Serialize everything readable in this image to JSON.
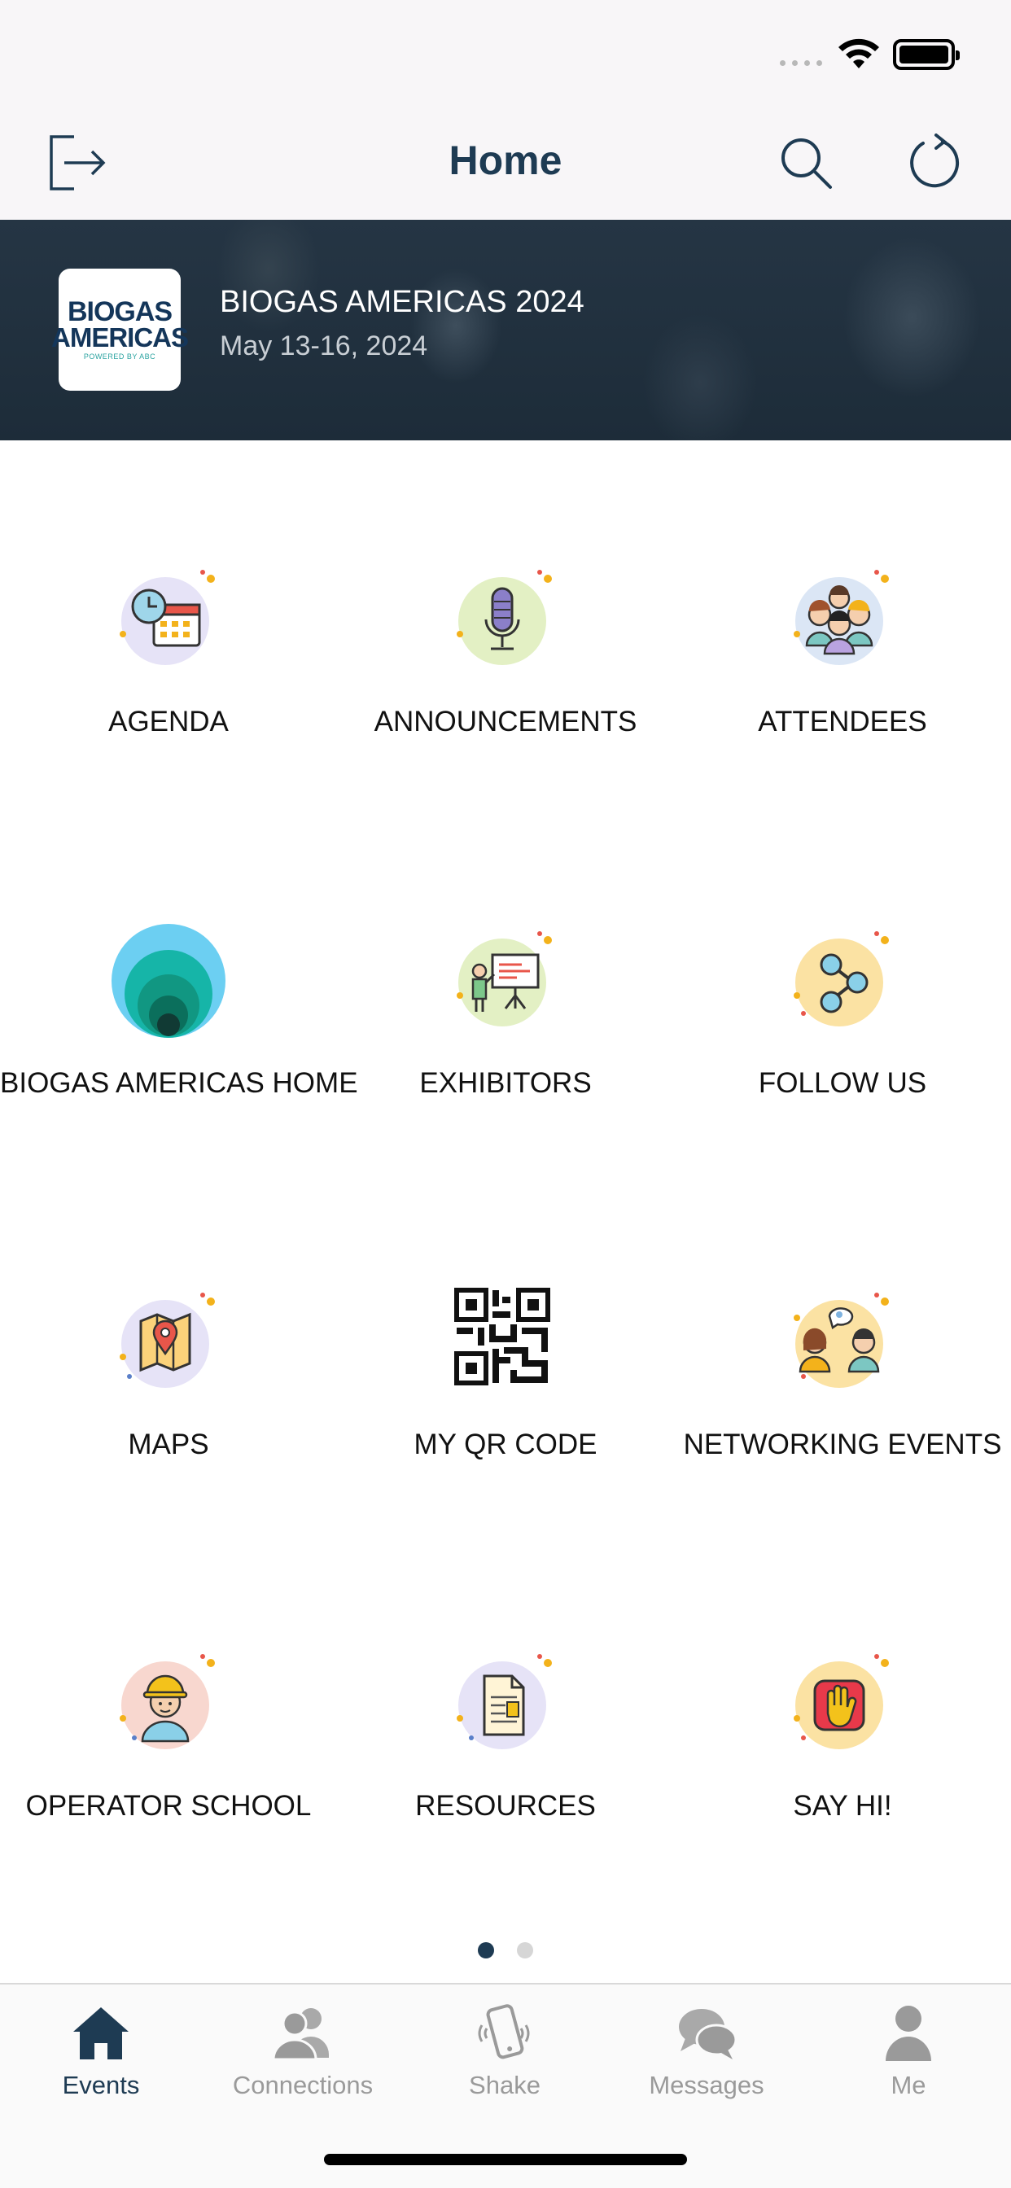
{
  "nav": {
    "title": "Home"
  },
  "event": {
    "name": "BIOGAS AMERICAS 2024",
    "dates": "May 13-16, 2024",
    "logo_line1": "BIOGAS",
    "logo_line2": "AMERICAS",
    "logo_line3": "POWERED BY ABC"
  },
  "tiles": [
    {
      "label": "AGENDA",
      "icon": "agenda-icon"
    },
    {
      "label": "ANNOUNCEMENTS",
      "icon": "microphone-icon"
    },
    {
      "label": "ATTENDEES",
      "icon": "attendees-icon"
    },
    {
      "label": "BIOGAS AMERICAS HOME",
      "icon": "biogas-home-icon"
    },
    {
      "label": "EXHIBITORS",
      "icon": "exhibitors-icon"
    },
    {
      "label": "FOLLOW US",
      "icon": "share-icon"
    },
    {
      "label": "MAPS",
      "icon": "map-icon"
    },
    {
      "label": "MY QR CODE",
      "icon": "qr-code-icon"
    },
    {
      "label": "NETWORKING EVENTS",
      "icon": "networking-icon"
    },
    {
      "label": "OPERATOR SCHOOL",
      "icon": "operator-icon"
    },
    {
      "label": "RESOURCES",
      "icon": "document-icon"
    },
    {
      "label": "SAY HI!",
      "icon": "wave-hand-icon"
    }
  ],
  "pager": {
    "pages": 2,
    "current": 1
  },
  "tabs": [
    {
      "label": "Events",
      "icon": "home-icon",
      "active": true
    },
    {
      "label": "Connections",
      "icon": "people-icon",
      "active": false
    },
    {
      "label": "Shake",
      "icon": "phone-shake-icon",
      "active": false
    },
    {
      "label": "Messages",
      "icon": "chat-icon",
      "active": false
    },
    {
      "label": "Me",
      "icon": "person-icon",
      "active": false
    }
  ],
  "colors": {
    "accent": "#1e3b53",
    "inactive": "#9a9a9a",
    "banner": "#1f2f3c"
  }
}
